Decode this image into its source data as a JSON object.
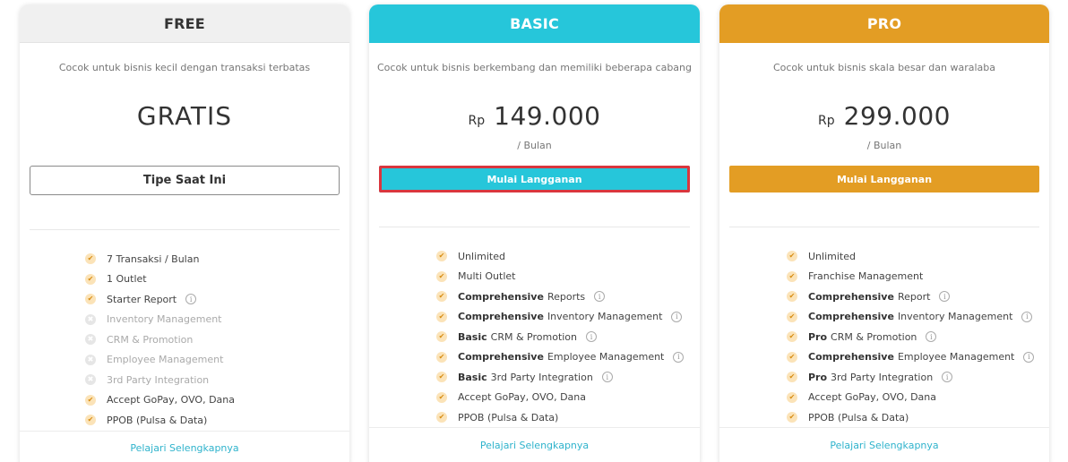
{
  "plans": {
    "free": {
      "name": "FREE",
      "description": "Cocok untuk bisnis kecil dengan transaksi terbatas",
      "price": "GRATIS",
      "button": "Tipe Saat Ini",
      "features": [
        {
          "bold": "",
          "text": "7 Transaksi / Bulan",
          "included": true,
          "info": false
        },
        {
          "bold": "",
          "text": "1 Outlet",
          "included": true,
          "info": false
        },
        {
          "bold": "",
          "text": "Starter Report",
          "included": true,
          "info": true
        },
        {
          "bold": "",
          "text": "Inventory Management",
          "included": false,
          "info": false
        },
        {
          "bold": "",
          "text": "CRM & Promotion",
          "included": false,
          "info": false
        },
        {
          "bold": "",
          "text": "Employee Management",
          "included": false,
          "info": false
        },
        {
          "bold": "",
          "text": "3rd Party Integration",
          "included": false,
          "info": false
        },
        {
          "bold": "",
          "text": "Accept GoPay, OVO, Dana",
          "included": true,
          "info": false
        },
        {
          "bold": "",
          "text": "PPOB (Pulsa & Data)",
          "included": true,
          "info": false
        }
      ],
      "learn_more": "Pelajari Selengkapnya"
    },
    "basic": {
      "name": "BASIC",
      "description": "Cocok untuk bisnis berkembang dan memiliki beberapa cabang",
      "currency": "Rp",
      "price": "149.000",
      "period": "/ Bulan",
      "button": "Mulai Langganan",
      "features": [
        {
          "bold": "",
          "text": "Unlimited",
          "included": true,
          "info": false
        },
        {
          "bold": "",
          "text": "Multi Outlet",
          "included": true,
          "info": false
        },
        {
          "bold": "Comprehensive",
          "text": "Reports",
          "included": true,
          "info": true
        },
        {
          "bold": "Comprehensive",
          "text": "Inventory Management",
          "included": true,
          "info": true
        },
        {
          "bold": "Basic",
          "text": "CRM & Promotion",
          "included": true,
          "info": true
        },
        {
          "bold": "Comprehensive",
          "text": "Employee Management",
          "included": true,
          "info": true
        },
        {
          "bold": "Basic",
          "text": "3rd Party Integration",
          "included": true,
          "info": true
        },
        {
          "bold": "",
          "text": "Accept GoPay, OVO, Dana",
          "included": true,
          "info": false
        },
        {
          "bold": "",
          "text": "PPOB (Pulsa & Data)",
          "included": true,
          "info": false
        }
      ],
      "learn_more": "Pelajari Selengkapnya"
    },
    "pro": {
      "name": "PRO",
      "description": "Cocok untuk bisnis skala besar dan waralaba",
      "currency": "Rp",
      "price": "299.000",
      "period": "/ Bulan",
      "button": "Mulai Langganan",
      "features": [
        {
          "bold": "",
          "text": "Unlimited",
          "included": true,
          "info": false
        },
        {
          "bold": "",
          "text": "Franchise Management",
          "included": true,
          "info": false
        },
        {
          "bold": "Comprehensive",
          "text": "Report",
          "included": true,
          "info": true
        },
        {
          "bold": "Comprehensive",
          "text": "Inventory Management",
          "included": true,
          "info": true
        },
        {
          "bold": "Pro",
          "text": "CRM & Promotion",
          "included": true,
          "info": true
        },
        {
          "bold": "Comprehensive",
          "text": "Employee Management",
          "included": true,
          "info": true
        },
        {
          "bold": "Pro",
          "text": "3rd Party Integration",
          "included": true,
          "info": true
        },
        {
          "bold": "",
          "text": "Accept GoPay, OVO, Dana",
          "included": true,
          "info": false
        },
        {
          "bold": "",
          "text": "PPOB (Pulsa & Data)",
          "included": true,
          "info": false
        }
      ],
      "learn_more": "Pelajari Selengkapnya"
    }
  },
  "icons": {
    "check": "check-icon",
    "cross": "cross-icon",
    "info": "info-icon"
  },
  "colors": {
    "basic_accent": "#26c6da",
    "pro_accent": "#e39d24",
    "free_header": "#f0f0f0",
    "check_bg": "#fbe3b8",
    "check_mark": "#d88d13",
    "link": "#2fb3cc",
    "highlight_border": "#d9363e"
  }
}
